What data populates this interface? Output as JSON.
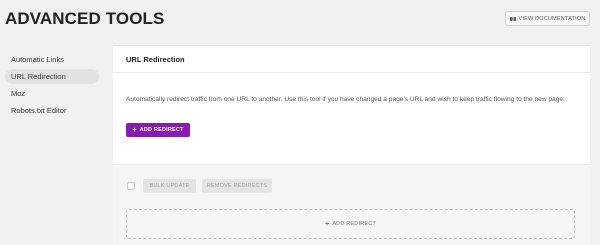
{
  "header": {
    "title": "ADVANCED TOOLS",
    "docs_button": "VIEW DOCUMENTATION",
    "docs_icon": "book-icon"
  },
  "sidebar": {
    "items": [
      {
        "label": "Automatic Links",
        "active": false
      },
      {
        "label": "URL Redirection",
        "active": true
      },
      {
        "label": "Moz",
        "active": false
      },
      {
        "label": "Robots.txt Editor",
        "active": false
      }
    ]
  },
  "panel": {
    "title": "URL Redirection",
    "description": "Automatically redirect traffic from one URL to another. Use this tool if you have changed a page's URL and wish to keep traffic flowing to the new page.",
    "add_button": "ADD REDIRECT",
    "bulk_update": "BULK UPDATE",
    "remove_redirects": "REMOVE REDIRECTS",
    "add_redirect_dashed": "ADD REDIRECT"
  },
  "colors": {
    "accent": "#8a1bb0",
    "background": "#f1f1f1"
  }
}
